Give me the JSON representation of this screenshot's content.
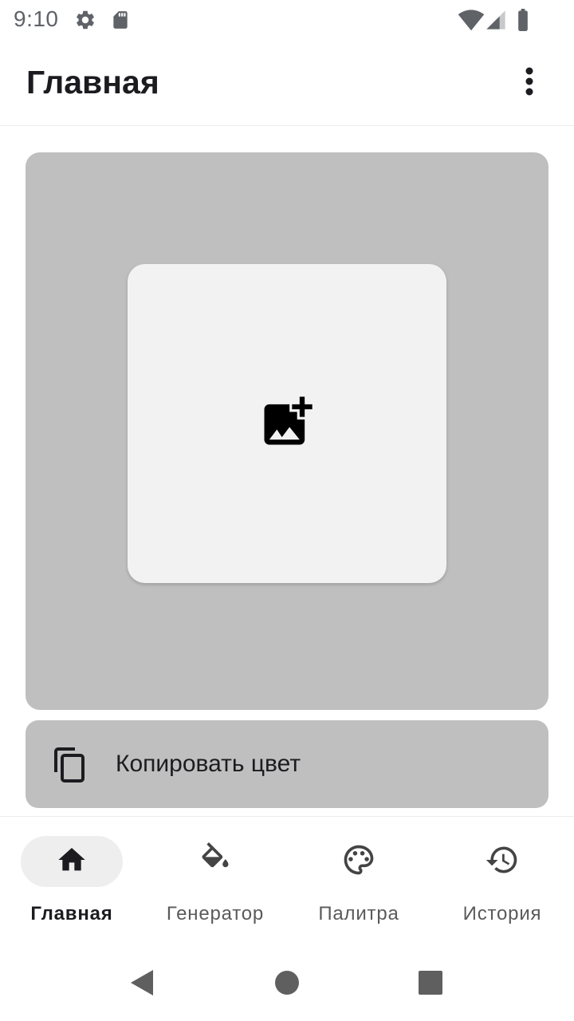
{
  "status_bar": {
    "time": "9:10",
    "left_icons": [
      "gear-icon",
      "sd-card-icon"
    ],
    "right_icons": [
      "wifi-icon",
      "signal-icon",
      "battery-icon"
    ]
  },
  "app_bar": {
    "title": "Главная",
    "overflow_icon": "more-vert-icon"
  },
  "preview": {
    "pick_image_icon": "add-photo-icon"
  },
  "copy_color": {
    "icon": "copy-icon",
    "label": "Копировать цвет"
  },
  "bottom_nav": {
    "items": [
      {
        "label": "Главная",
        "icon": "home-icon",
        "active": true
      },
      {
        "label": "Генератор",
        "icon": "paint-bucket-icon",
        "active": false
      },
      {
        "label": "Палитра",
        "icon": "palette-icon",
        "active": false
      },
      {
        "label": "История",
        "icon": "history-icon",
        "active": false
      }
    ]
  },
  "system_nav": {
    "buttons": [
      "back-icon",
      "home-circle-icon",
      "recents-icon"
    ]
  },
  "colors": {
    "card_background": "#bfbfbf",
    "image_button_background": "#f2f2f2",
    "active_nav_pill": "#eeeeee",
    "text_primary": "#1c1b1f"
  }
}
